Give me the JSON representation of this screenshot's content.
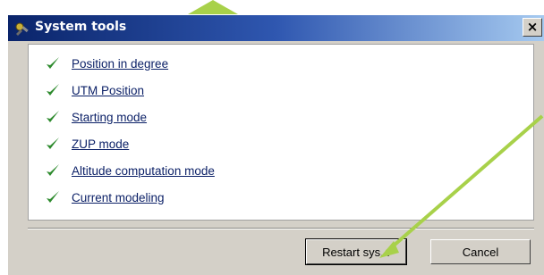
{
  "dialog": {
    "title": "System tools",
    "close_label": "×",
    "items": [
      {
        "label": "Position in degree",
        "icon": "check-icon"
      },
      {
        "label": "UTM Position",
        "icon": "check-icon"
      },
      {
        "label": "Starting mode",
        "icon": "check-icon"
      },
      {
        "label": "ZUP mode",
        "icon": "check-icon"
      },
      {
        "label": "Altitude computation mode",
        "icon": "check-icon"
      },
      {
        "label": "Current modeling",
        "icon": "check-icon"
      }
    ],
    "buttons": {
      "restart_label": "Restart sys...",
      "cancel_label": "Cancel"
    }
  },
  "colors": {
    "check": "#2e8b2e",
    "annotation": "#a8d14a",
    "link": "#0a1f66",
    "titlebar_start": "#0a246a"
  }
}
